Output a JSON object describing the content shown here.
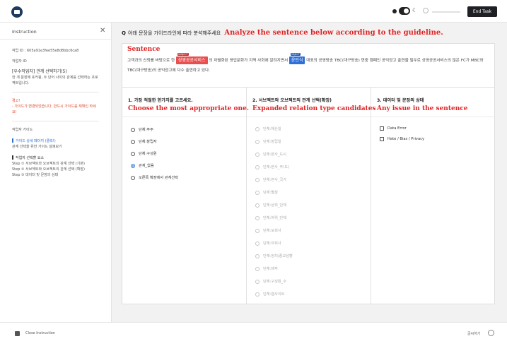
{
  "topbar": {
    "end_task_label": "End Task",
    "progress_fraction": 0.0
  },
  "sidebar": {
    "title": "Instruction",
    "task_id_line": "작업 ID : 605a91e3fee55e8d8bbc6ca8",
    "worker_id_label": "작업자 ID",
    "task_title": "[우수작업자] 관계 선택하기(5)",
    "task_desc": "한 개 문장에 포커핑, 두 단어 사이의 관계를 선택하는 프로젝트입니다.",
    "warning_title": "경고!",
    "warning_text": "- 가이드가 변경되었습니다. 반드시 가이드를 재확인 하세요!",
    "guide_section_title": "작업자 가이드",
    "guide_link": "가이드 상세 페이지 (클릭!)",
    "guide_link_sub": "관계 선택을 위한 가이드 살펴보기",
    "steps_title": "작업자 선택할 요소",
    "steps": [
      "Step ① 서브젝트와 오브젝트의 관계 선택 (기본)",
      "Step ② 서브젝트와 오브젝트의 관계 선택 (확장)",
      "Step ③ 데이터 및 문장의 상태"
    ]
  },
  "main": {
    "question_mark": "Q",
    "question_ko": "아래 문장을 가이드라인에 따라 분석해주세요",
    "question_en": "Analyze the sentence below according to the guideline.",
    "sentence": {
      "title": "Sentence",
      "part1": "고객과의 신뢰를 바탕으로 한",
      "subject_tag": "SUBJECT",
      "subject": "상영공공서비스",
      "part2": "의 차별화된 영업문화가 지역 사회에 알려지면서",
      "object_tag": "OBJECT",
      "object": "윤인식",
      "part3": "대표의 공영방송 TBC(대구방송) 연중 캠페인 공익광고 출연을 필두로 상영공공서비스의 많은 FC가 MBC와 TBC(대구방송)의 공익광고에 다수 출연하고 있다."
    }
  },
  "panels": {
    "p1": {
      "head": "1. 가장 적절한 한가지를 고르세요.",
      "sub": "Choose the most appropriate one.",
      "options": [
        "단체:주주",
        "단체:창립자",
        "단체:구성원",
        "관계_없음",
        "오른쪽 확장에서 관계선택"
      ],
      "selected_index": 3
    },
    "p2": {
      "head": "2. 서브젝트와 오브젝트의 관계 선택(확장)",
      "sub": "Expanded relation type candidates",
      "options": [
        "단체:해산일",
        "단체:창립일",
        "단체:본사_도시",
        "단체:본사_주(도)",
        "단체:본사_국가",
        "단체:별칭",
        "단체:상위_단체",
        "단체:하위_단체",
        "단체:모회사",
        "단체:자회사",
        "단체:정치/종교성향",
        "단체:제작",
        "단체:구성원_수",
        "단체:웹사이트"
      ]
    },
    "p3": {
      "head": "3. 데이터 및 문장의 상태",
      "sub": "Any issue in the sentence",
      "checks": [
        "Data Error",
        "Hate / Bias / Privacy"
      ]
    }
  },
  "bottombar": {
    "close_label": "Close Instruction",
    "right_label": "글씨하기"
  }
}
